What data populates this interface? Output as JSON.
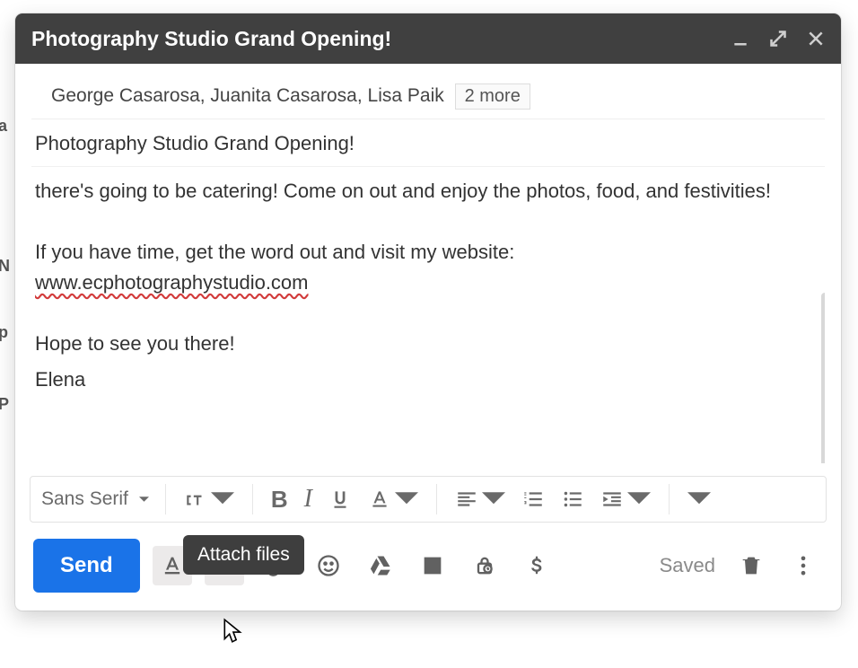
{
  "left_peek": {
    "a": "a",
    "b": "N",
    "c": "p",
    "d": "P"
  },
  "header": {
    "title": "Photography Studio Grand Opening!"
  },
  "recipients": {
    "names": "George Casarosa, Juanita Casarosa, Lisa Paik",
    "more_label": "2 more"
  },
  "subject": "Photography Studio Grand Opening!",
  "body": {
    "p1": "there's going to be catering! Come on out and enjoy the photos, food, and festivities!",
    "p2a": "If you have time, get the word out and visit my website: ",
    "p2_link": "www.ecphotographystudio.com",
    "p3": "Hope to see you there!",
    "p4": "Elena"
  },
  "format_toolbar": {
    "font_family": "Sans Serif",
    "bold": "B",
    "italic": "I"
  },
  "tooltip": {
    "attach_files": "Attach files"
  },
  "bottom": {
    "send_label": "Send",
    "saved_label": "Saved"
  }
}
